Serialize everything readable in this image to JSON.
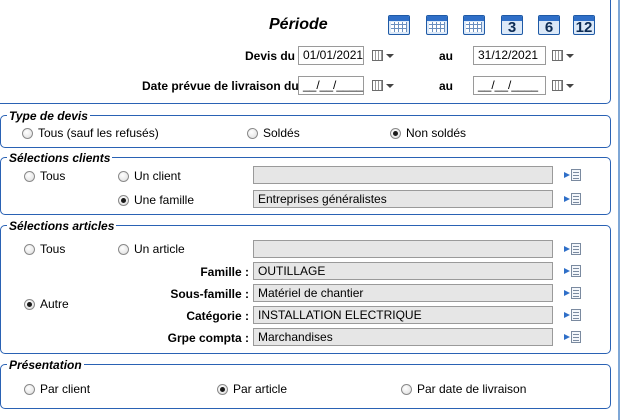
{
  "periode": {
    "title": "Période",
    "calendar_buttons": [
      {
        "icon": "calendar-day-icon",
        "label": ""
      },
      {
        "icon": "calendar-week-icon",
        "label": ""
      },
      {
        "icon": "calendar-month-icon",
        "label": ""
      },
      {
        "icon": "calendar-3-months-icon",
        "label": "3"
      },
      {
        "icon": "calendar-6-months-icon",
        "label": "6"
      },
      {
        "icon": "calendar-12-months-icon",
        "label": "12"
      }
    ],
    "devis_label": "Devis du",
    "devis_from": "01/01/2021",
    "devis_to_label": "au",
    "devis_to": "31/12/2021",
    "livraison_label": "Date prévue de livraison du",
    "livraison_from": "__/__/____",
    "livraison_to_label": "au",
    "livraison_to": "__/__/____"
  },
  "type_devis": {
    "legend": "Type de devis",
    "options": [
      {
        "label": "Tous (sauf les refusés)",
        "selected": false
      },
      {
        "label": "Soldés",
        "selected": false
      },
      {
        "label": "Non soldés",
        "selected": true
      }
    ]
  },
  "clients": {
    "legend": "Sélections clients",
    "all_label": "Tous",
    "one_label": "Un client",
    "one_value": "",
    "family_label": "Une famille",
    "family_value": "Entreprises généralistes",
    "selected": "family"
  },
  "articles": {
    "legend": "Sélections articles",
    "all_label": "Tous",
    "one_label": "Un article",
    "one_value": "",
    "other_label": "Autre",
    "selected": "other",
    "fields": [
      {
        "label": "Famille :",
        "value": "OUTILLAGE"
      },
      {
        "label": "Sous-famille :",
        "value": "Matériel de chantier"
      },
      {
        "label": "Catégorie :",
        "value": "INSTALLATION ELECTRIQUE"
      },
      {
        "label": "Grpe compta :",
        "value": "Marchandises"
      }
    ]
  },
  "presentation": {
    "legend": "Présentation",
    "options": [
      {
        "label": "Par client",
        "selected": false
      },
      {
        "label": "Par article",
        "selected": true
      },
      {
        "label": "Par date de livraison",
        "selected": false
      }
    ]
  },
  "colors": {
    "panel_border": "#2a62b4",
    "field_bg": "#e6e6e6",
    "accent": "#2f6fc8"
  }
}
